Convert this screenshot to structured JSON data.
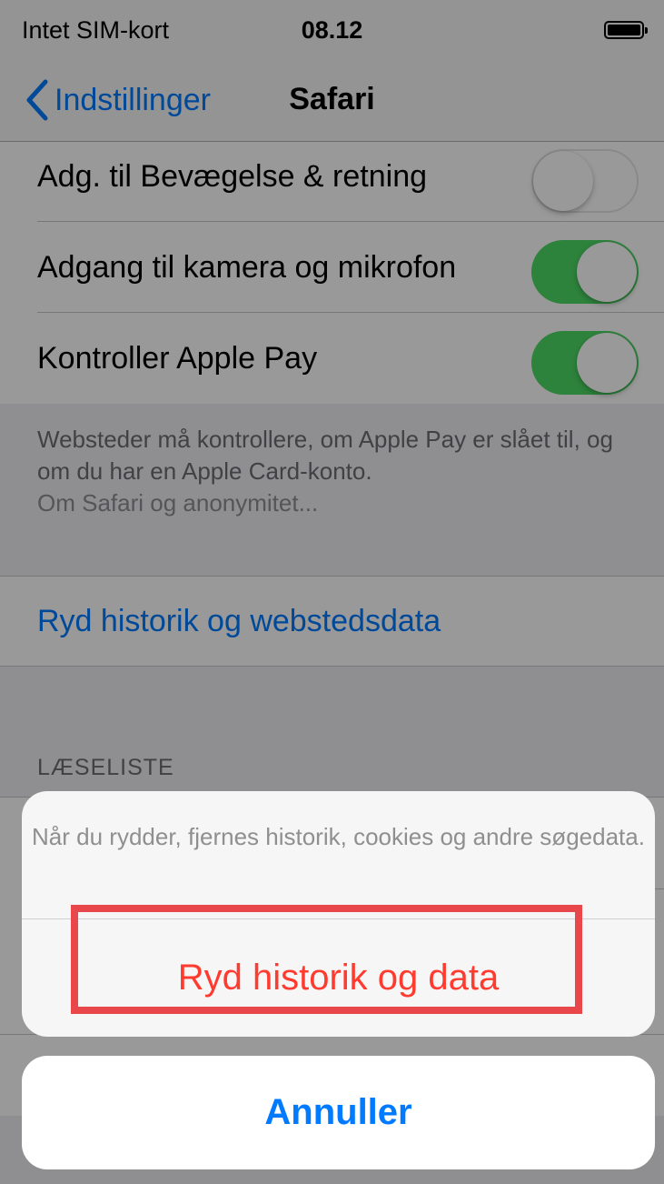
{
  "status_bar": {
    "carrier": "Intet SIM-kort",
    "time": "08.12",
    "battery_icon": "battery-full-icon"
  },
  "nav": {
    "back_label": "Indstillinger",
    "back_icon": "chevron-left-icon",
    "title": "Safari"
  },
  "settings": {
    "rows": [
      {
        "label": "Adg. til Bevægelse & retning",
        "toggle_on": false
      },
      {
        "label": "Adgang til kamera og mikrofon",
        "toggle_on": true
      },
      {
        "label": "Kontroller Apple Pay",
        "toggle_on": true
      }
    ],
    "footnote": "Websteder må kontrollere, om Apple Pay er slået til, og om du har en Apple Card-konto.",
    "footnote_link": "Om Safari og anonymitet...",
    "clear_history_label": "Ryd historik og webstedsdata",
    "section_header": "LÆSELISTE"
  },
  "action_sheet": {
    "message": "Når du rydder, fjernes historik, cookies og andre søgedata.",
    "destructive_label": "Ryd historik og data",
    "cancel_label": "Annuller"
  },
  "colors": {
    "accent": "#007aff",
    "toggle_on": "#4cd964",
    "destructive": "#ff3b30",
    "highlight": "#e8474c"
  }
}
